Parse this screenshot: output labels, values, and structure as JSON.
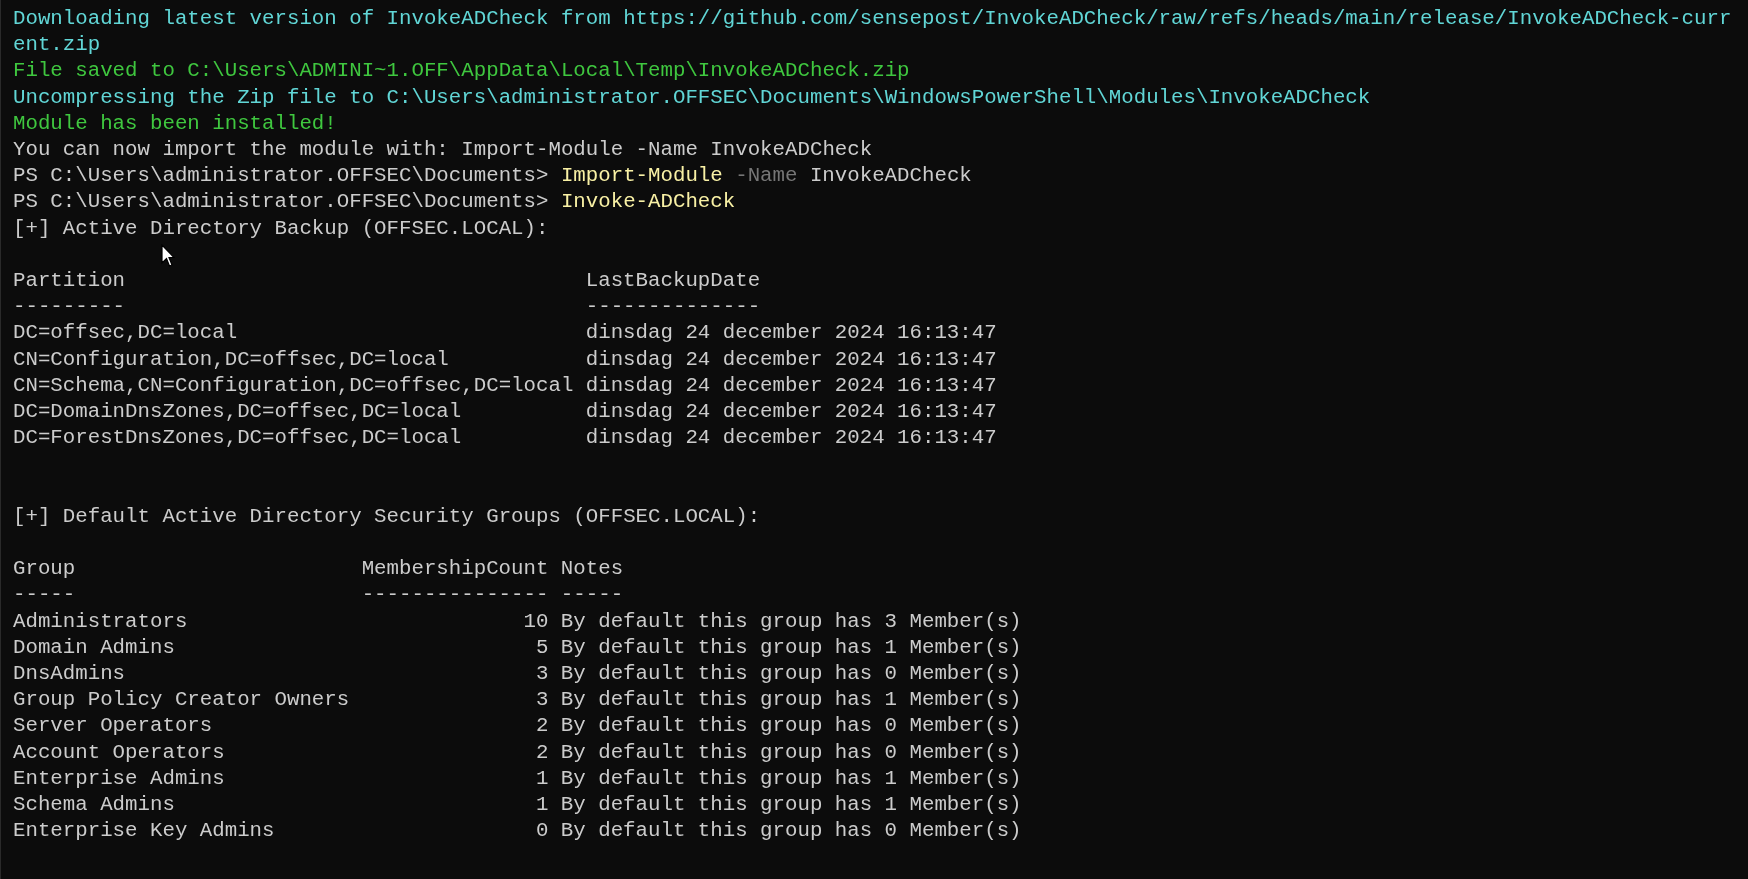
{
  "terminal": {
    "lines": [
      {
        "kind": "info",
        "text": "Downloading latest version of InvokeADCheck from https://github.com/sensepost/InvokeADCheck/raw/refs/heads/main/release/InvokeADCheck-current.zip"
      },
      {
        "kind": "success",
        "text": "File saved to C:\\Users\\ADMINI~1.OFF\\AppData\\Local\\Temp\\InvokeADCheck.zip"
      },
      {
        "kind": "info",
        "text": "Uncompressing the Zip file to C:\\Users\\administrator.OFFSEC\\Documents\\WindowsPowerShell\\Modules\\InvokeADCheck"
      },
      {
        "kind": "success",
        "text": "Module has been installed!"
      },
      {
        "kind": "output",
        "text": "You can now import the module with: Import-Module -Name InvokeADCheck"
      },
      {
        "kind": "prompt",
        "prompt": "PS C:\\Users\\administrator.OFFSEC\\Documents>",
        "command": "Import-Module",
        "parameter": "-Name",
        "argument": "InvokeADCheck"
      },
      {
        "kind": "prompt",
        "prompt": "PS C:\\Users\\administrator.OFFSEC\\Documents>",
        "command": "Invoke-ADCheck"
      },
      {
        "kind": "output",
        "text": "[+] Active Directory Backup (OFFSEC.LOCAL):"
      },
      {
        "kind": "blank"
      },
      {
        "kind": "table",
        "columns": [
          {
            "header": "Partition",
            "rule": "---------",
            "numeric": false
          },
          {
            "header": "LastBackupDate",
            "rule": "--------------",
            "numeric": false
          }
        ],
        "rows": [
          [
            "DC=offsec,DC=local",
            "dinsdag 24 december 2024 16:13:47"
          ],
          [
            "CN=Configuration,DC=offsec,DC=local",
            "dinsdag 24 december 2024 16:13:47"
          ],
          [
            "CN=Schema,CN=Configuration,DC=offsec,DC=local",
            "dinsdag 24 december 2024 16:13:47"
          ],
          [
            "DC=DomainDnsZones,DC=offsec,DC=local",
            "dinsdag 24 december 2024 16:13:47"
          ],
          [
            "DC=ForestDnsZones,DC=offsec,DC=local",
            "dinsdag 24 december 2024 16:13:47"
          ]
        ]
      },
      {
        "kind": "blank"
      },
      {
        "kind": "blank"
      },
      {
        "kind": "output",
        "text": "[+] Default Active Directory Security Groups (OFFSEC.LOCAL):"
      },
      {
        "kind": "blank"
      },
      {
        "kind": "table",
        "columns": [
          {
            "header": "Group",
            "rule": "-----",
            "numeric": false
          },
          {
            "header": "MembershipCount",
            "rule": "---------------",
            "numeric": true
          },
          {
            "header": "Notes",
            "rule": "-----",
            "numeric": false
          }
        ],
        "rows": [
          [
            "Administrators",
            "10",
            "By default this group has 3 Member(s)"
          ],
          [
            "Domain Admins",
            "5",
            "By default this group has 1 Member(s)"
          ],
          [
            "DnsAdmins",
            "3",
            "By default this group has 0 Member(s)"
          ],
          [
            "Group Policy Creator Owners",
            "3",
            "By default this group has 1 Member(s)"
          ],
          [
            "Server Operators",
            "2",
            "By default this group has 0 Member(s)"
          ],
          [
            "Account Operators",
            "2",
            "By default this group has 0 Member(s)"
          ],
          [
            "Enterprise Admins",
            "1",
            "By default this group has 1 Member(s)"
          ],
          [
            "Schema Admins",
            "1",
            "By default this group has 1 Member(s)"
          ],
          [
            "Enterprise Key Admins",
            "0",
            "By default this group has 0 Member(s)"
          ]
        ]
      }
    ]
  }
}
